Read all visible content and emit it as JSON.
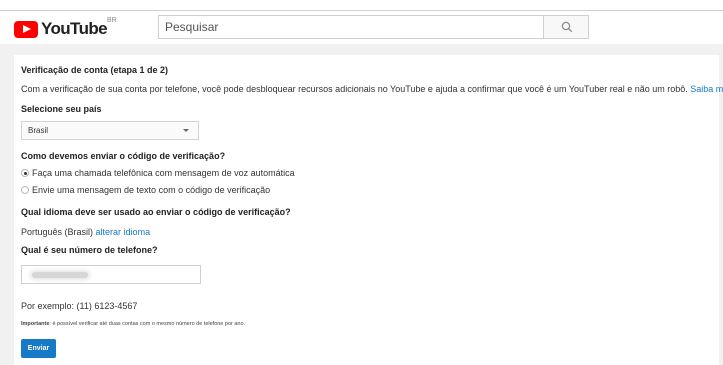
{
  "header": {
    "logo_text": "YouTube",
    "region": "BR",
    "search_placeholder": "Pesquisar"
  },
  "verification": {
    "title": "Verificação de conta (etapa 1 de 2)",
    "intro": "Com a verificação de sua conta por telefone, você pode desbloquear recursos adicionais no YouTube e ajuda a confirmar que você é um YouTuber real e não um robô.",
    "learn_more": "Saiba mais",
    "country_label": "Selecione seu país",
    "country_value": "Brasil",
    "method_label": "Como devemos enviar o código de verificação?",
    "methods": [
      {
        "label": "Faça uma chamada telefônica com mensagem de voz automática",
        "selected": true
      },
      {
        "label": "Envie uma mensagem de texto com o código de verificação",
        "selected": false
      }
    ],
    "language_label": "Qual idioma deve ser usado ao enviar o código de verificação?",
    "language_value": "Português (Brasil)",
    "change_language": "alterar idioma",
    "phone_label": "Qual é seu número de telefone?",
    "example": "Por exemplo: (11) 6123-4567",
    "note_bold": "Importante",
    "note_text": ": é possível verificar até duas contas com o mesmo número de telefone por ano.",
    "submit": "Enviar"
  }
}
